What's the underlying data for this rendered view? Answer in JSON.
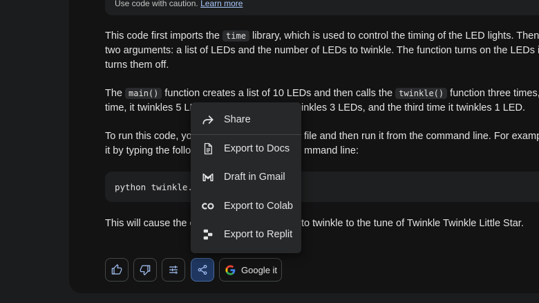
{
  "caution": {
    "text": "Use code with caution.",
    "link": "Learn more"
  },
  "paragraphs": {
    "p1": {
      "line1_a": "This code first imports the ",
      "line1_code": "time",
      "line1_b": " library, which is used to control the timing of the LED lights. Then, i",
      "line2": "two arguments: a list of LEDs and the number of LEDs to twinkle. The function turns on the LEDs in th",
      "line3": "turns them off."
    },
    "p2": {
      "line1_a": "The ",
      "line1_code1": "main()",
      "line1_b": " function creates a list of 10 LEDs and then calls the ",
      "line1_code2": "twinkle()",
      "line1_c": " function three times, e",
      "line2_a": "time, it twinkles 5 LE",
      "line2_b": "inkles 3 LEDs, and the third time it twinkles 1 LED."
    },
    "p3": {
      "line1_a": "To run this code, yo",
      "line1_b": "file and then run it from the command line. For example,",
      "line2_a": "it by typing the follo",
      "line2_b": "mmand line:"
    },
    "p4": {
      "line1_a": "This will cause the c",
      "line1_b": "to twinkle to the tune of Twinkle Twinkle Little Star."
    }
  },
  "codeblock": {
    "text": "python twinkle.p"
  },
  "menu": {
    "items": [
      {
        "label": "Share",
        "icon": "share-arrow-icon"
      },
      {
        "label": "Export to Docs",
        "icon": "docs-icon"
      },
      {
        "label": "Draft in Gmail",
        "icon": "gmail-icon"
      },
      {
        "label": "Export to Colab",
        "icon": "colab-icon"
      },
      {
        "label": "Export to Replit",
        "icon": "replit-icon"
      }
    ]
  },
  "actions": {
    "thumbs_up": "thumbs-up-icon",
    "thumbs_down": "thumbs-down-icon",
    "modify": "tune-icon",
    "share": "share-icon",
    "google_label": "Google it"
  },
  "colors": {
    "background": "#131314",
    "accent": "#a8c7fa",
    "menu": "#27282a"
  }
}
